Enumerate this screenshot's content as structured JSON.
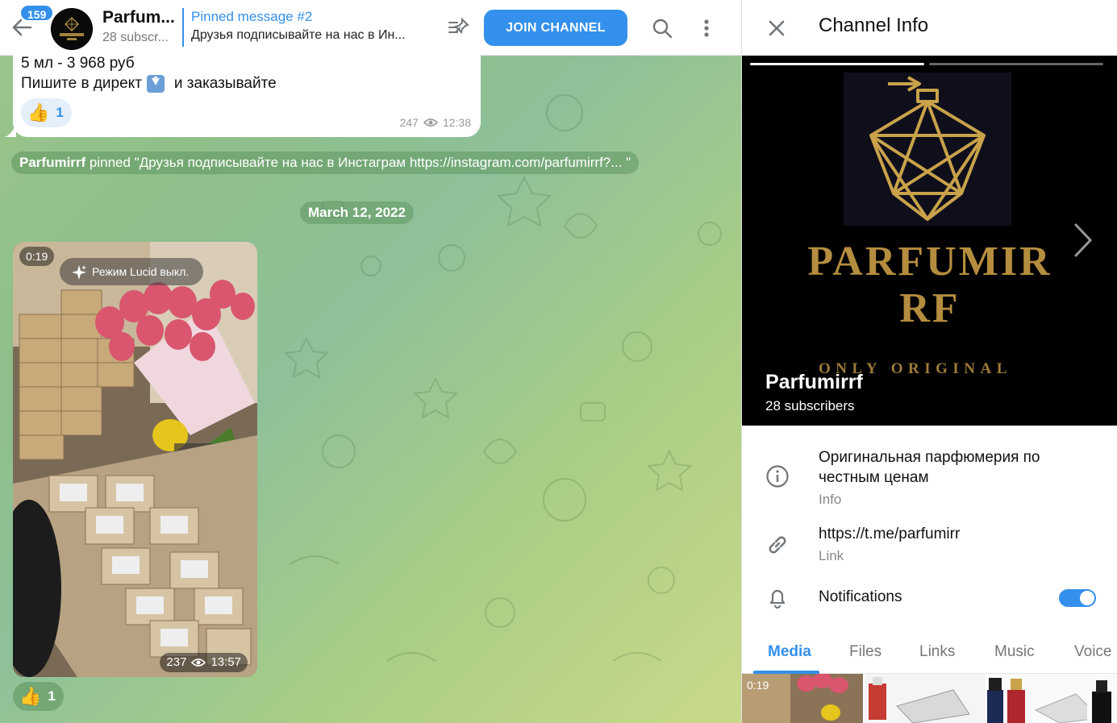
{
  "chat_header": {
    "unread_count": "159",
    "title": "Parfum...",
    "subscribers": "28 subscr...",
    "pinned_title": "Pinned message #2",
    "pinned_text": "Друзья подписывайте на нас в Ин...",
    "join_label": "JOIN CHANNEL"
  },
  "message1": {
    "line1": "5 мл - 3 968 руб",
    "line2_before": "Пишите в директ",
    "line2_after": "и заказывайте",
    "reaction_count": "1",
    "views": "247",
    "time": "12:38"
  },
  "service_pinned": {
    "author": "Parfumirrf",
    "text": " pinned \"Друзья подписывайте на нас в Инстаграм https://instagram.com/parfumirrf?... \""
  },
  "date_separator": "March 12, 2022",
  "video_message": {
    "duration": "0:19",
    "lucid_label": "Режим Lucid выкл.",
    "views": "237",
    "time": "13:57",
    "reaction_count": "1"
  },
  "info_panel": {
    "title": "Channel Info",
    "logo_text_line1": "PARFUMIR",
    "logo_text_line2": "RF",
    "logo_tagline": "ONLY ORIGINAL",
    "channel_name": "Parfumirrf",
    "subscribers": "28 subscribers",
    "description": "Оригинальная парфюмерия по честным ценам",
    "description_label": "Info",
    "link": "https://t.me/parfumirr",
    "link_label": "Link",
    "notifications_label": "Notifications",
    "notifications_enabled": true,
    "tabs": [
      "Media",
      "Files",
      "Links",
      "Music",
      "Voice"
    ],
    "active_tab": "Media",
    "media_first_duration": "0:19"
  },
  "colors": {
    "accent": "#3390ec",
    "gold": "#b58d3e"
  },
  "icons": [
    "back-arrow-icon",
    "pinned-list-icon",
    "search-icon",
    "more-vert-icon",
    "eye-icon",
    "sparkle-icon",
    "close-icon",
    "chevron-right-icon",
    "info-icon",
    "link-icon",
    "bell-icon"
  ]
}
